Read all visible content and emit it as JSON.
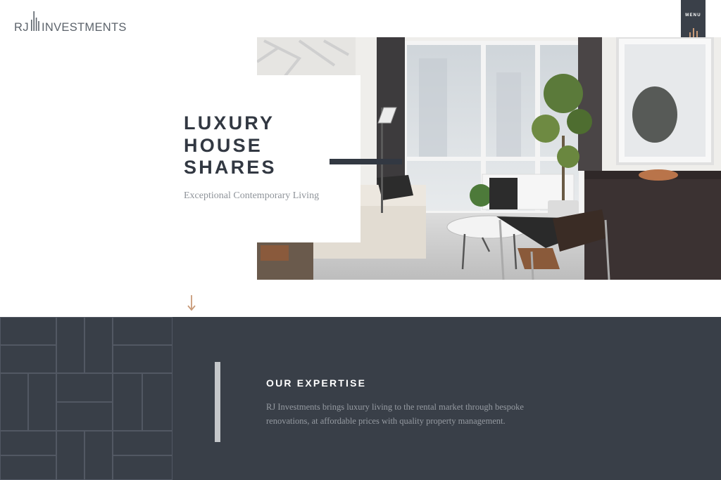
{
  "brand": {
    "logo_initials": "RJ",
    "logo_word": "INVESTMENTS",
    "logo_color": "#5c636b"
  },
  "menu": {
    "label": "MENU",
    "icon": "bars-icon",
    "background": "#3a4049",
    "icon_color": "#c89a78"
  },
  "hero": {
    "title_lines": [
      "LUXURY",
      "HOUSE",
      "SHARES"
    ],
    "subtitle": "Exceptional Contemporary Living",
    "image": "living-room-photo",
    "scroll_icon": "arrow-down-icon",
    "accent_color": "#c89a78"
  },
  "expertise": {
    "title": "OUR EXPERTISE",
    "text": "RJ Investments brings luxury living to the rental market through bespoke renovations, at affordable prices with quality property management.",
    "background": "#393f48"
  }
}
